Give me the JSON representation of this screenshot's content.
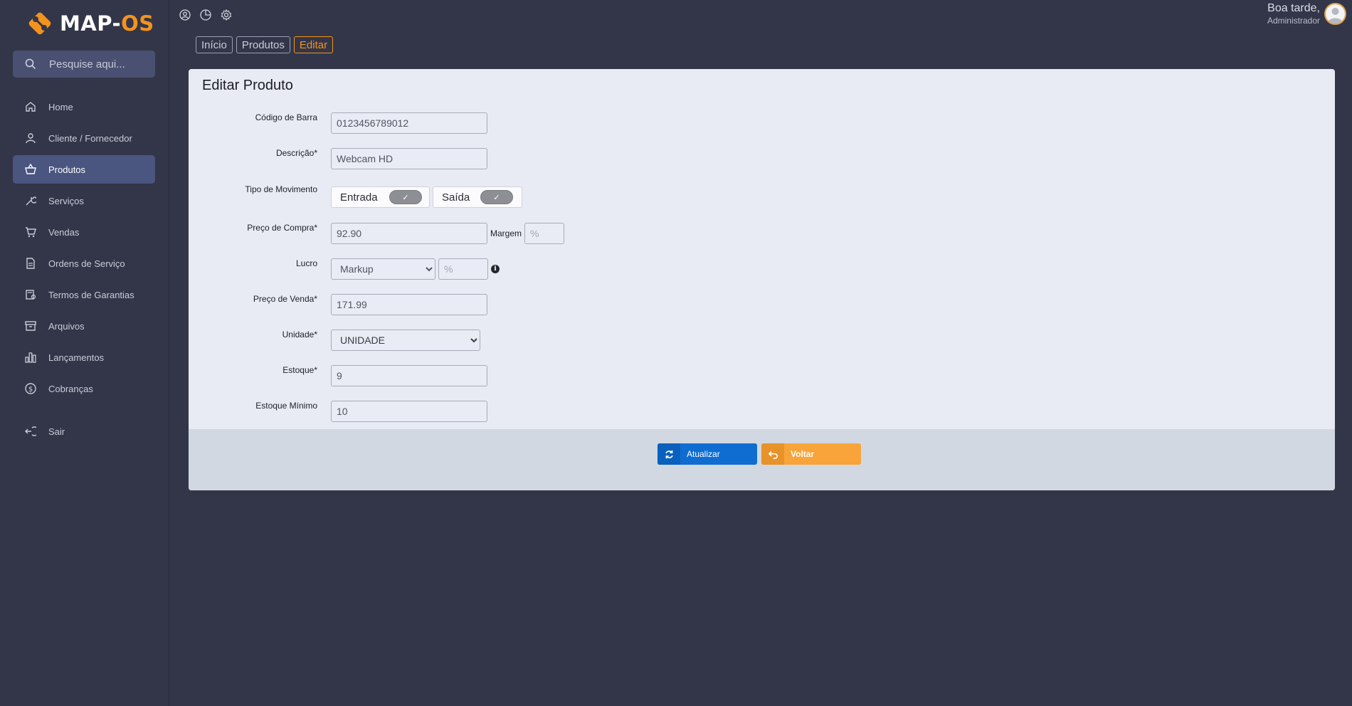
{
  "app": {
    "logo_text": "MAP-",
    "logo_accent": "OS",
    "accent_color": "#f3931d"
  },
  "search": {
    "placeholder": "Pesquise aqui..."
  },
  "sidebar": {
    "items": [
      {
        "label": "Home",
        "icon": "home-icon"
      },
      {
        "label": "Cliente / Fornecedor",
        "icon": "user-icon"
      },
      {
        "label": "Produtos",
        "icon": "basket-icon",
        "active": true
      },
      {
        "label": "Serviços",
        "icon": "wrench-icon"
      },
      {
        "label": "Vendas",
        "icon": "cart-icon"
      },
      {
        "label": "Ordens de Serviço",
        "icon": "document-icon"
      },
      {
        "label": "Termos de Garantias",
        "icon": "certificate-icon"
      },
      {
        "label": "Arquivos",
        "icon": "archive-icon"
      },
      {
        "label": "Lançamentos",
        "icon": "bar-chart-icon"
      },
      {
        "label": "Cobranças",
        "icon": "dollar-icon"
      }
    ],
    "exit_label": "Sair"
  },
  "header": {
    "greeting": "Boa tarde,",
    "role": "Administrador"
  },
  "breadcrumb": [
    "Início",
    "Produtos",
    "Editar"
  ],
  "form": {
    "title": "Editar Produto",
    "barcode_label": "Código de Barra",
    "barcode_value": "0123456789012",
    "description_label": "Descrição*",
    "description_value": "Webcam HD",
    "movement_label": "Tipo de Movimento",
    "movement_in": "Entrada",
    "movement_out": "Saída",
    "purchase_label": "Preço de Compra*",
    "purchase_value": "92.90",
    "margin_label": "Margem",
    "margin_placeholder": "%",
    "profit_label": "Lucro",
    "profit_selected": "Markup",
    "profit_placeholder": "%",
    "sale_label": "Preço de Venda*",
    "sale_value": "171.99",
    "unit_label": "Unidade*",
    "unit_selected": "UNIDADE",
    "stock_label": "Estoque*",
    "stock_value": "9",
    "min_stock_label": "Estoque Mínimo",
    "min_stock_value": "10"
  },
  "actions": {
    "update_label": "Atualizar",
    "back_label": "Voltar"
  }
}
